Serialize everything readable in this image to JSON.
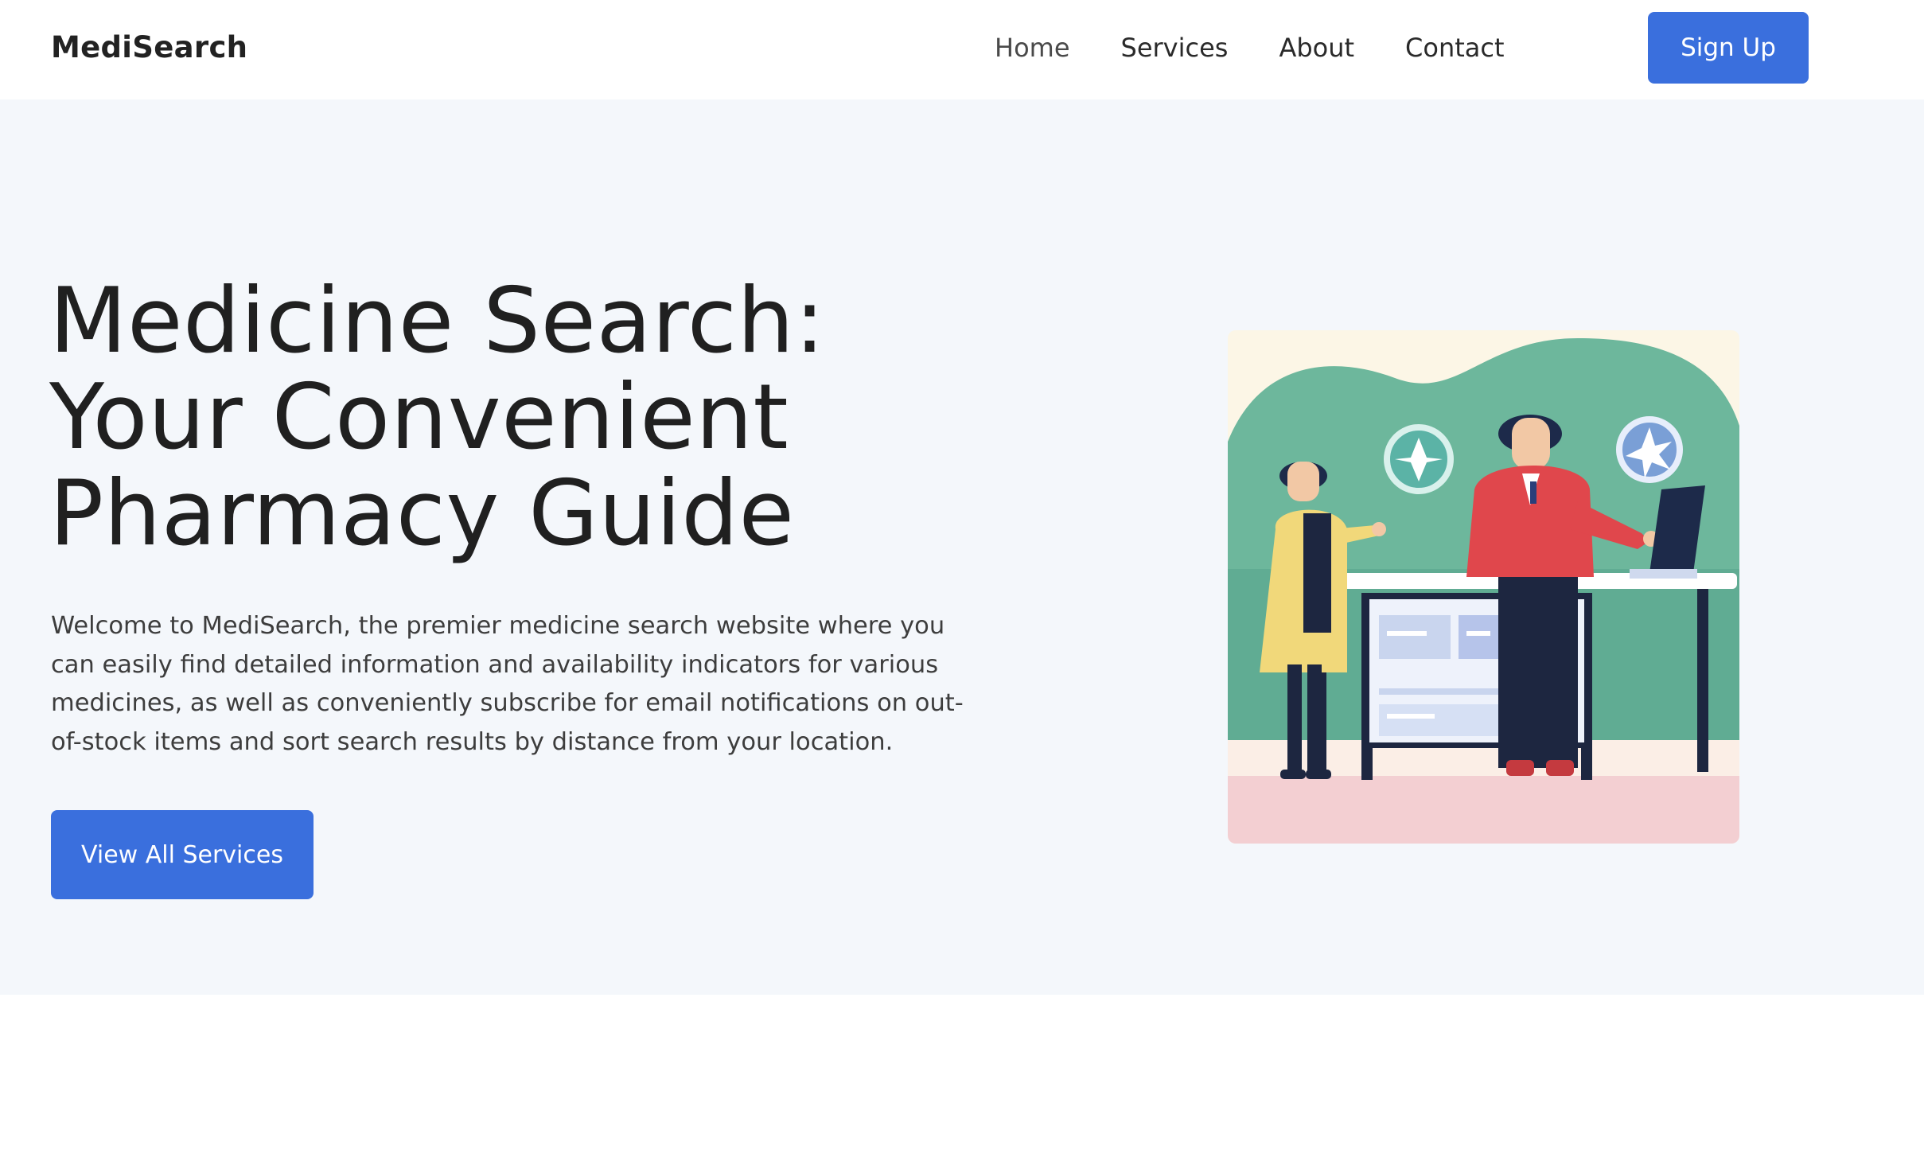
{
  "nav": {
    "brand": "MediSearch",
    "links": [
      "Home",
      "Services",
      "About",
      "Contact"
    ],
    "signup_label": "Sign Up"
  },
  "hero": {
    "title_lines": [
      "Medicine Search:",
      "Your Convenient",
      "Pharmacy Guide"
    ],
    "description": "Welcome to MediSearch, the premier medicine search website where you can easily find detailed information and availability indicators for various medicines, as well as conveniently subscribe for email notifications on out-of-stock items and sort search results by distance from your location.",
    "cta_label": "View All Services"
  },
  "colors": {
    "accent": "#3a6fdd",
    "hero_background": "#f4f7fb",
    "illustration_wave": "#6bb39b",
    "illustration_floor": "#f3cfd2"
  }
}
